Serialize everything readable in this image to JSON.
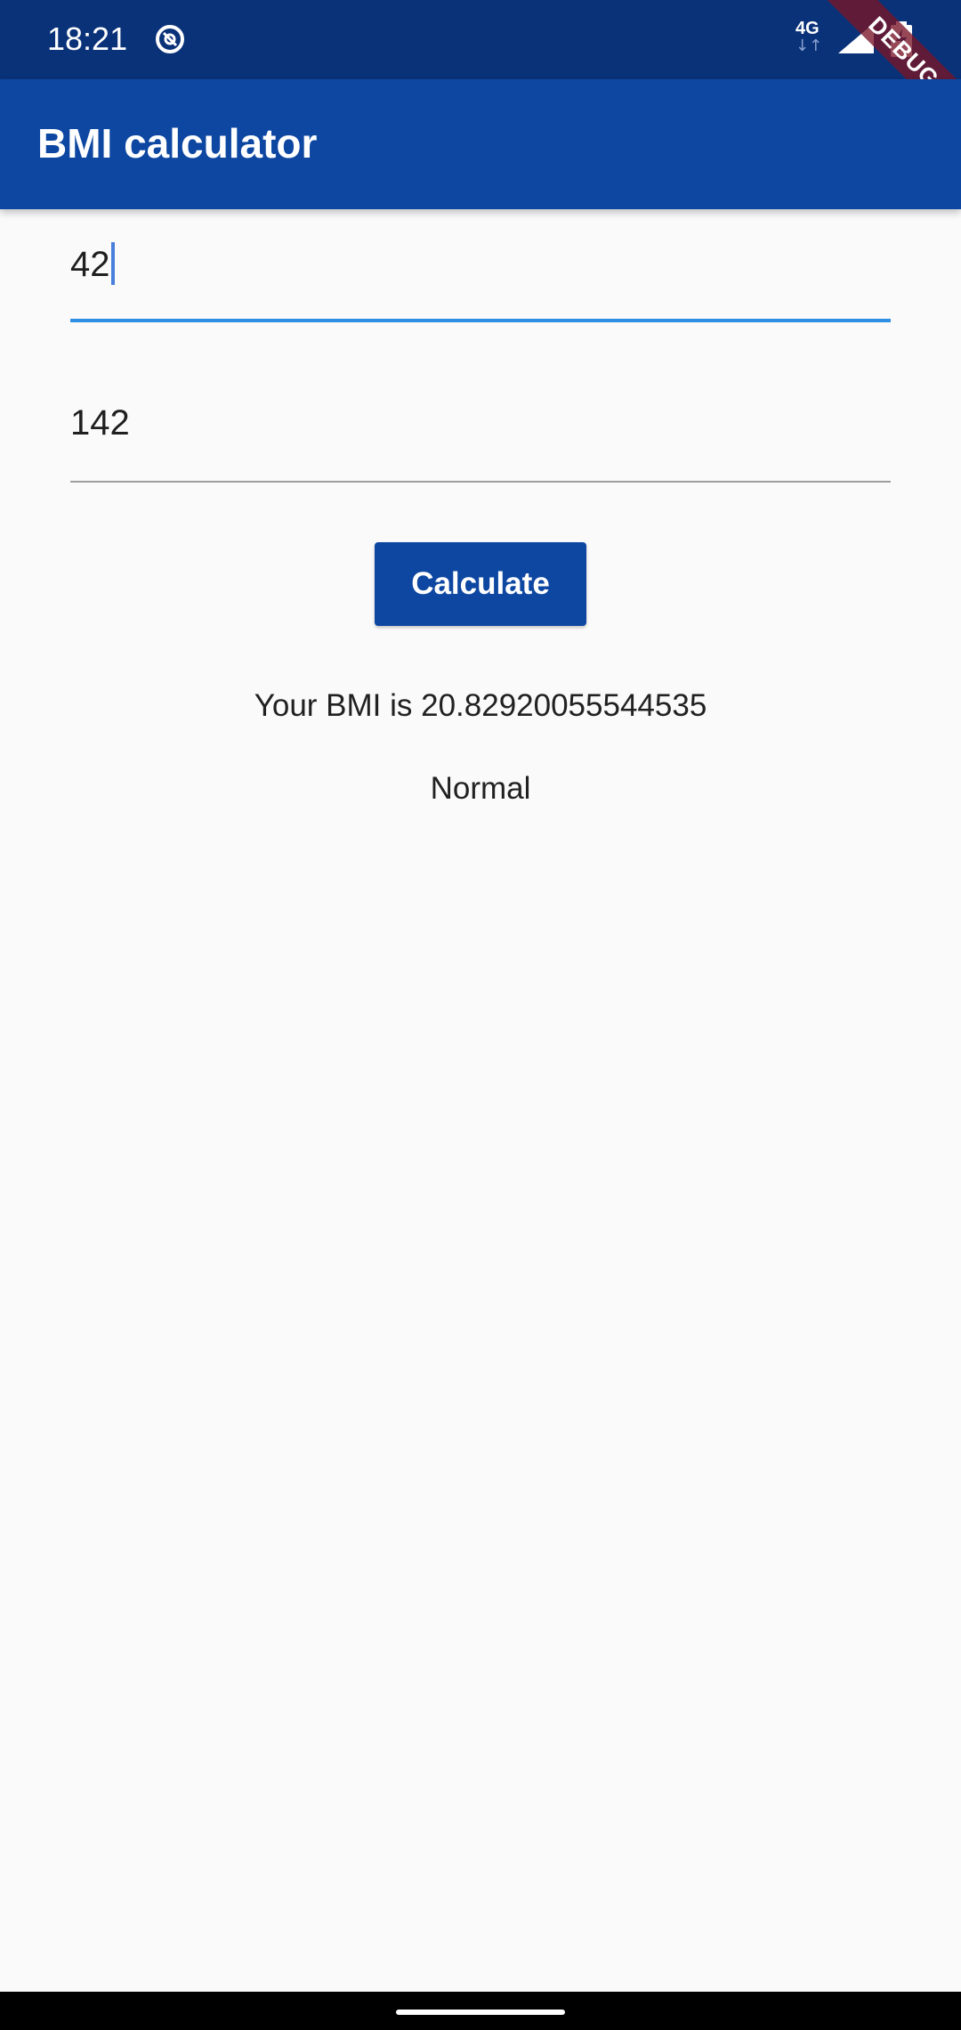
{
  "status_bar": {
    "time": "18:21",
    "network_label": "4G",
    "network_arrows": "↓↑",
    "app_icon": "data-saver-icon",
    "signal_icon": "signal-icon",
    "battery_icon": "battery-charging-icon",
    "background_color": "#0a3279"
  },
  "debug_banner": {
    "label": "DEBUG"
  },
  "app_bar": {
    "title": "BMI calculator",
    "color": "#0d47a1"
  },
  "form": {
    "weight_value": "42",
    "height_value": "142",
    "focus_color": "#2e8fe3"
  },
  "actions": {
    "calculate_label": "Calculate"
  },
  "result": {
    "bmi_text": "Your BMI is 20.82920055544535",
    "category": "Normal"
  }
}
